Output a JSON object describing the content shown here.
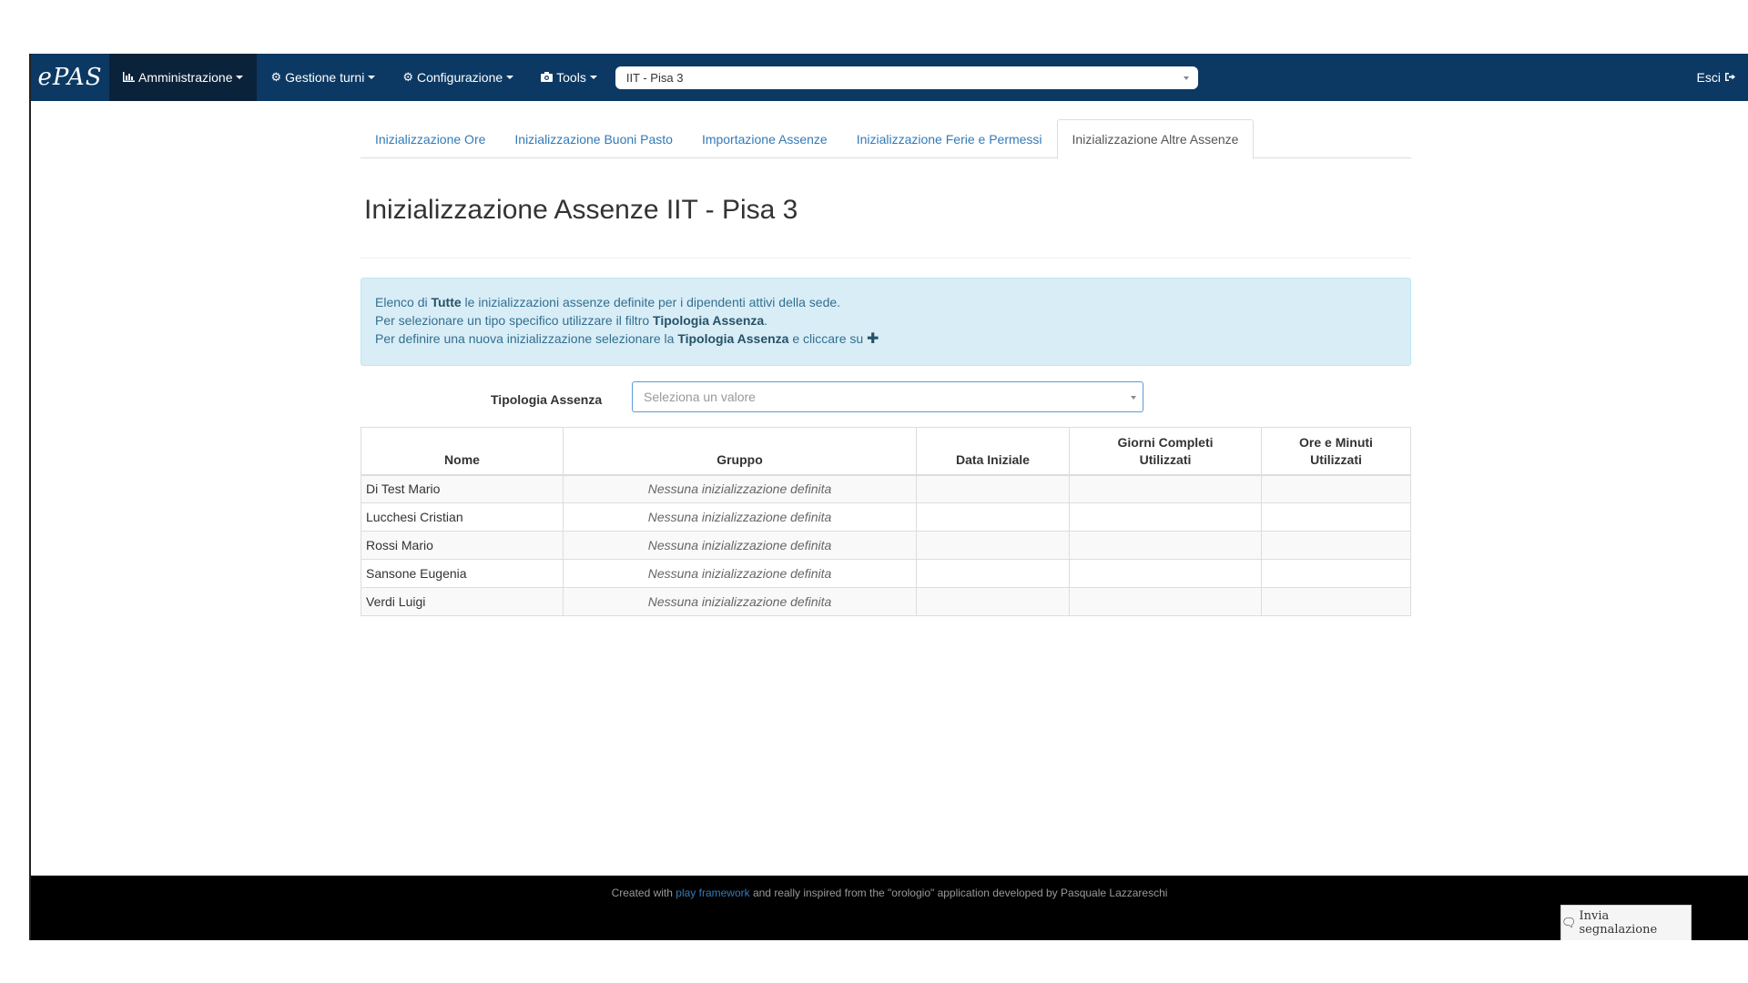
{
  "navbar": {
    "brand": "ePAS",
    "menus": [
      {
        "label": "Amministrazione",
        "icon": "bar-chart-icon"
      },
      {
        "label": "Gestione turni",
        "icon": "gear-icon"
      },
      {
        "label": "Configurazione",
        "icon": "gear-icon"
      },
      {
        "label": "Tools",
        "icon": "camera-icon"
      }
    ],
    "office_select": "IIT - Pisa 3",
    "logout": "Esci"
  },
  "tabs": [
    {
      "label": "Inizializzazione Ore"
    },
    {
      "label": "Inizializzazione Buoni Pasto"
    },
    {
      "label": "Importazione Assenze"
    },
    {
      "label": "Inizializzazione Ferie e Permessi"
    },
    {
      "label": "Inizializzazione Altre Assenze",
      "active": true
    }
  ],
  "page": {
    "title": "Inizializzazione Assenze IIT - Pisa 3"
  },
  "info": {
    "line1_a": "Elenco di ",
    "line1_b": "Tutte",
    "line1_c": " le inizializzazioni assenze definite per i dipendenti attivi della sede.",
    "line2_a": "Per selezionare un tipo specifico utilizzare il filtro ",
    "line2_b": "Tipologia Assenza",
    "line2_c": ".",
    "line3_a": "Per definire una nuova inizializzazione selezionare la ",
    "line3_b": "Tipologia Assenza",
    "line3_c": " e cliccare su "
  },
  "filter": {
    "label": "Tipologia Assenza",
    "placeholder": "Seleziona un valore"
  },
  "table": {
    "headers": {
      "nome": "Nome",
      "gruppo": "Gruppo",
      "data_iniziale": "Data Iniziale",
      "giorni_1": "Giorni Completi",
      "giorni_2": "Utilizzati",
      "ore_1": "Ore e Minuti",
      "ore_2": "Utilizzati"
    },
    "rows": [
      {
        "nome": "Di Test Mario",
        "gruppo": "Nessuna inizializzazione definita"
      },
      {
        "nome": "Lucchesi Cristian",
        "gruppo": "Nessuna inizializzazione definita"
      },
      {
        "nome": "Rossi Mario",
        "gruppo": "Nessuna inizializzazione definita"
      },
      {
        "nome": "Sansone Eugenia",
        "gruppo": "Nessuna inizializzazione definita"
      },
      {
        "nome": "Verdi Luigi",
        "gruppo": "Nessuna inizializzazione definita"
      }
    ]
  },
  "footer": {
    "text_a": "Created with ",
    "link": "play framework",
    "text_b": " and really inspired from the \"orologio\" application developed by Pasquale Lazzareschi",
    "report_button": "Invia segnalazione"
  }
}
